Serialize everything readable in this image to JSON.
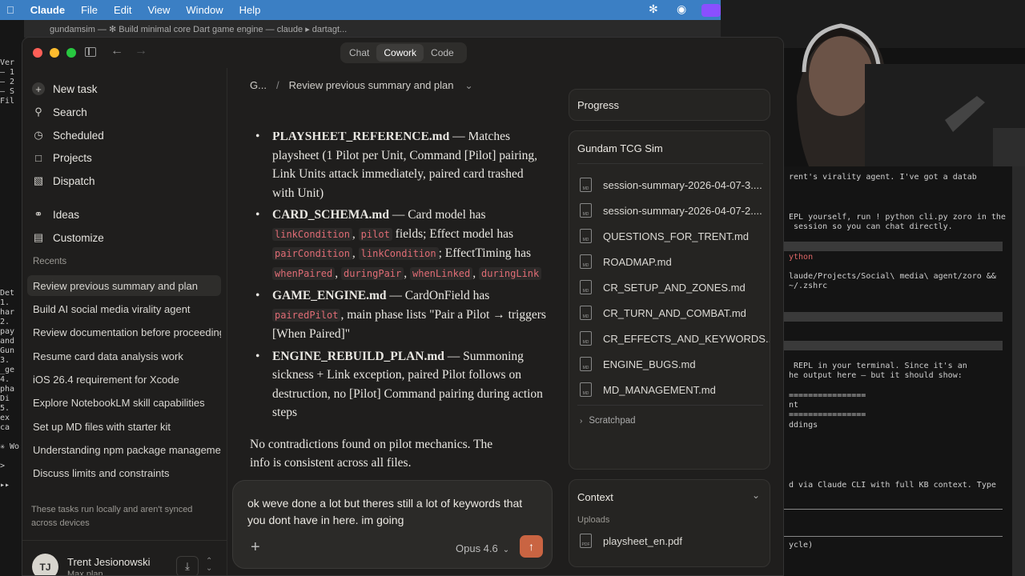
{
  "menubar": {
    "app": "Claude",
    "items": [
      "File",
      "Edit",
      "View",
      "Window",
      "Help"
    ]
  },
  "bg_window_title": "gundamsim — ✻ Build minimal core Dart game engine — claude ▸ dartagt...",
  "bg_terminal_left": [
    "Ver",
    "— 1",
    "— 2",
    "— S",
    "Fil",
    "",
    "",
    "",
    "",
    "",
    "",
    "",
    "",
    "",
    "",
    "",
    "",
    "",
    "",
    "",
    "",
    "",
    "",
    "",
    "Det",
    "1.",
    "har",
    "2.",
    "pay",
    "and",
    "Gun",
    "3.",
    "_ge",
    "4.",
    "pha",
    "Di",
    "5.",
    "ex",
    "ca",
    "",
    "✳ Wo",
    "",
    ">",
    "",
    "▸▸"
  ],
  "window": {
    "mode_tabs": [
      {
        "label": "Chat",
        "active": false
      },
      {
        "label": "Cowork",
        "active": true
      },
      {
        "label": "Code",
        "active": false
      }
    ]
  },
  "sidebar": {
    "nav": [
      {
        "label": "New task",
        "icon": "plus-icon"
      },
      {
        "label": "Search",
        "icon": "search-icon"
      },
      {
        "label": "Scheduled",
        "icon": "clock-icon"
      },
      {
        "label": "Projects",
        "icon": "folder-icon"
      },
      {
        "label": "Dispatch",
        "icon": "dispatch-icon"
      },
      {
        "label": "Ideas",
        "icon": "lightbulb-icon"
      },
      {
        "label": "Customize",
        "icon": "briefcase-icon"
      }
    ],
    "recents_label": "Recents",
    "recents": [
      "Review previous summary and plan",
      "Build AI social media virality agent",
      "Review documentation before proceeding",
      "Resume card data analysis work",
      "iOS 26.4 requirement for Xcode",
      "Explore NotebookLM skill capabilities",
      "Set up MD files with starter kit",
      "Understanding npm package management",
      "Discuss limits and constraints"
    ],
    "local_note": "These tasks run locally and aren't synced across devices",
    "user": {
      "initials": "TJ",
      "name": "Trent Jesionowski",
      "plan": "Max plan"
    }
  },
  "main": {
    "breadcrumb_parent": "G...",
    "breadcrumb_sep": "/",
    "breadcrumb_current": "Review previous summary and plan",
    "item0": {
      "title": "PLAYSHEET_REFERENCE.md",
      "text": " — Matches playsheet (1 Pilot per Unit, Command [Pilot] pairing, Link Units attack immediately, paired card trashed with Unit)"
    },
    "item1": {
      "title": "CARD_SCHEMA.md",
      "t1": " — Card model has ",
      "c1": "linkCondition",
      "s1": ", ",
      "c2": "pilot",
      "t2": " fields; Effect model has ",
      "c3": "pairCondition",
      "s2": ", ",
      "c4": "linkCondition",
      "t3": "; EffectTiming has ",
      "c5": "whenPaired",
      "s3": ", ",
      "c6": "duringPair",
      "s4": ", ",
      "c7": "whenLinked",
      "s5": ", ",
      "c8": "duringLink"
    },
    "item2": {
      "title": "GAME_ENGINE.md",
      "t1": " — CardOnField has ",
      "c1": "pairedPilot",
      "t2": ", main phase lists \"Pair a Pilot → triggers [When Paired]\""
    },
    "item3": {
      "title": "ENGINE_REBUILD_PLAN.md",
      "text": " — Summoning sickness + Link exception, paired Pilot follows on destruction, no [Pilot] Command pairing during action steps"
    },
    "conclusion": "No contradictions found on pilot mechanics. The info is consistent across all files."
  },
  "composer": {
    "text": "ok weve done a lot but theres still a lot of keywords that you dont have in here. im going",
    "model": "Opus 4.6"
  },
  "right_panel": {
    "progress_label": "Progress",
    "project_name": "Gundam TCG Sim",
    "files": [
      "session-summary-2026-04-07-3....",
      "session-summary-2026-04-07-2....",
      "QUESTIONS_FOR_TRENT.md",
      "ROADMAP.md",
      "CR_SETUP_AND_ZONES.md",
      "CR_TURN_AND_COMBAT.md",
      "CR_EFFECTS_AND_KEYWORDS....",
      "ENGINE_BUGS.md",
      "MD_MANAGEMENT.md"
    ],
    "scratchpad": "Scratchpad",
    "context_label": "Context",
    "uploads_label": "Uploads",
    "upload_file": "playsheet_en.pdf"
  },
  "right_terminal": [
    "rent's virality agent. I've got a datab",
    "EPL yourself, run ! python cli.py zoro in the",
    " session so you can chat directly.",
    "ython",
    "laude/Projects/Social\\ media\\ agent/zoro &&",
    "~/.zshrc",
    " REPL in your terminal. Since it's an",
    "he output here — but it should show:",
    "================",
    "nt",
    "================",
    "ddings",
    "d via Claude CLI with full KB context. Type",
    "ycle)"
  ]
}
